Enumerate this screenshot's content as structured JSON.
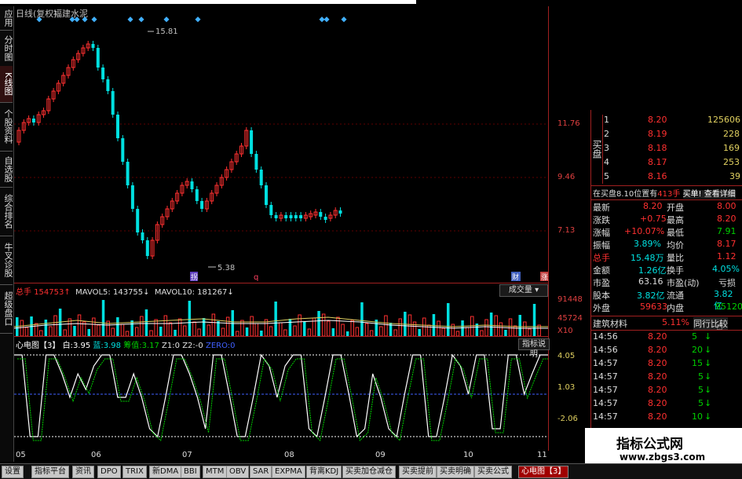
{
  "chart_header": {
    "kline_label": "日线(复权)",
    "stock_name": "福建水泥"
  },
  "sidebar": [
    {
      "label": "应用",
      "active": false
    },
    {
      "label": "分时图",
      "active": false
    },
    {
      "label": "K线图",
      "active": true
    },
    {
      "label": "个股资料",
      "active": false
    },
    {
      "label": "自选股",
      "active": false
    },
    {
      "label": "综合排名",
      "active": false
    },
    {
      "label": "牛叉诊股",
      "active": false
    },
    {
      "label": "超级盘口",
      "active": false
    }
  ],
  "price_axis": [
    "11.76",
    "9.46",
    "7.13"
  ],
  "annotations": {
    "high": "15.81",
    "low": "5.38",
    "marker_left": "拐",
    "marker_q": "q",
    "marker_cai": "财",
    "marker_zhang": "涨"
  },
  "volume": {
    "title": "总手",
    "total": "154753",
    "mavol5_label": "MAVOL5:",
    "mavol5": "143755",
    "mavol10_label": "MAVOL10:",
    "mavol10": "181267",
    "dropdown": "成交量",
    "axis": [
      "91448",
      "45724",
      "X10"
    ]
  },
  "indicator": {
    "title": "心电图【3】",
    "white_label": "白:",
    "white": "3.95",
    "blue_label": "蓝:",
    "blue": "3.98",
    "ma_label": "筹值:",
    "ma": "3.17",
    "z1_label": "Z1:",
    "z1": "0",
    "z2_label": "Z2:",
    "z2": "-0",
    "zero_label": "ZERO:",
    "zero": "0",
    "help": "指标说明",
    "axis": [
      "4.05",
      "1.03",
      "-2.06"
    ]
  },
  "dates": [
    "05",
    "06",
    "07",
    "08",
    "09",
    "10",
    "11"
  ],
  "order_book": {
    "buy_label": "买盘",
    "rows": [
      {
        "level": "1",
        "price": "8.20",
        "vol": "125606"
      },
      {
        "level": "2",
        "price": "8.19",
        "vol": "228"
      },
      {
        "level": "3",
        "price": "8.18",
        "vol": "169"
      },
      {
        "level": "4",
        "price": "8.17",
        "vol": "253"
      },
      {
        "level": "5",
        "price": "8.16",
        "vol": "39"
      }
    ],
    "notice_left": "在买盘8.10位置有",
    "notice_count": "413手",
    "notice_right": "买单! 查看详细"
  },
  "quote": [
    {
      "l1": "最新",
      "v1": "8.20",
      "l2": "开盘",
      "v2": "8.00"
    },
    {
      "l1": "涨跌",
      "v1": "+0.75",
      "l2": "最高",
      "v2": "8.20"
    },
    {
      "l1": "涨幅",
      "v1": "+10.07%",
      "l2": "最低",
      "v2": "7.91"
    },
    {
      "l1": "振幅",
      "v1": "3.89%",
      "l2": "均价",
      "v2": "8.17"
    },
    {
      "l1": "总手",
      "v1": "15.48万",
      "l2": "量比",
      "v2": "1.12"
    },
    {
      "l1": "金额",
      "v1": "1.26亿",
      "l2": "换手",
      "v2": "4.05%"
    },
    {
      "l1": "市盈",
      "v1": "63.16",
      "l2": "市盈(动)",
      "v2": "亏损"
    },
    {
      "l1": "股本",
      "v1": "3.82亿",
      "l2": "流通",
      "v2": "3.82亿"
    },
    {
      "l1": "外盘",
      "v1": "59633",
      "l2": "内盘",
      "v2": "95120"
    }
  ],
  "sector": {
    "name": "建筑材料",
    "pct": "5.11%",
    "compare": "同行比较"
  },
  "ticks": [
    {
      "time": "14:56",
      "price": "8.20",
      "vol": "5"
    },
    {
      "time": "14:56",
      "price": "8.20",
      "vol": "20"
    },
    {
      "time": "14:57",
      "price": "8.20",
      "vol": "15"
    },
    {
      "time": "14:57",
      "price": "8.20",
      "vol": "5"
    },
    {
      "time": "14:57",
      "price": "8.20",
      "vol": "5"
    },
    {
      "time": "14:57",
      "price": "8.20",
      "vol": "5"
    },
    {
      "time": "14:57",
      "price": "8.20",
      "vol": "10"
    }
  ],
  "tabs": [
    {
      "label": "设置",
      "active": false
    },
    {
      "label": "指标平台",
      "active": false
    },
    {
      "label": "资讯",
      "active": false
    },
    {
      "label": "DPO",
      "active": false
    },
    {
      "label": "TRIX",
      "active": false
    },
    {
      "label": "新DMA",
      "active": false
    },
    {
      "label": "BBI",
      "active": false
    },
    {
      "label": "MTM",
      "active": false
    },
    {
      "label": "OBV",
      "active": false
    },
    {
      "label": "SAR",
      "active": false
    },
    {
      "label": "EXPMA",
      "active": false
    },
    {
      "label": "背离KDJ",
      "active": false
    },
    {
      "label": "买卖加仓减仓",
      "active": false
    },
    {
      "label": "买卖提前",
      "active": false
    },
    {
      "label": "买卖明确",
      "active": false
    },
    {
      "label": "买卖公式",
      "active": false
    },
    {
      "label": "心电图【3】",
      "active": true
    }
  ],
  "watermark": {
    "title": "指标公式网",
    "url": "www.zbgs3.com"
  },
  "colors": {
    "up": "#ff3030",
    "down": "#00e0e0",
    "ma": "#e0d060",
    "panel_border": "#a02020"
  }
}
